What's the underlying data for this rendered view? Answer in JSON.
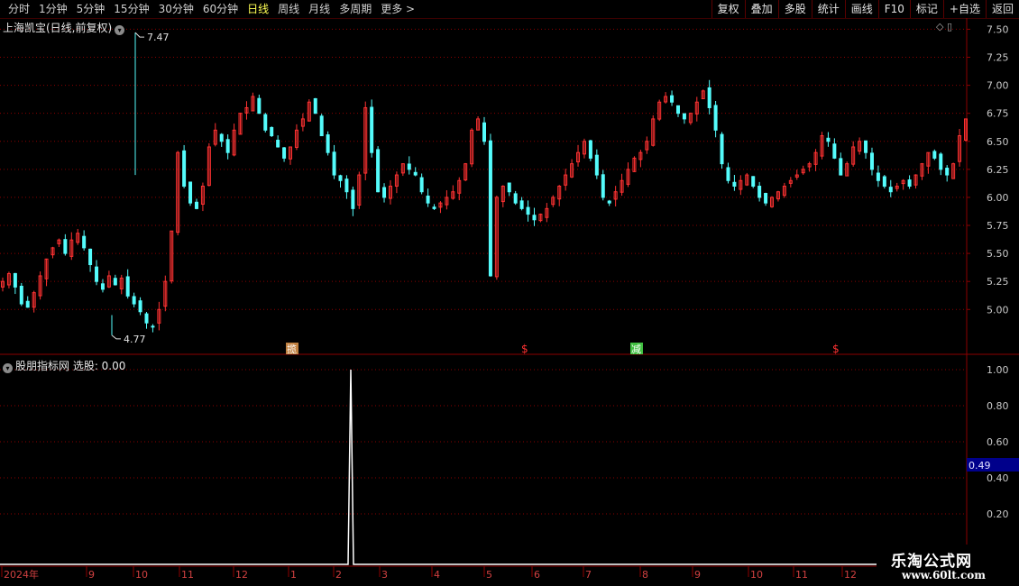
{
  "toolbar": {
    "periods": [
      "分时",
      "1分钟",
      "5分钟",
      "15分钟",
      "30分钟",
      "60分钟",
      "日线",
      "周线",
      "月线",
      "多周期",
      "更多 >"
    ],
    "active_period": "日线",
    "buttons": [
      "复权",
      "叠加",
      "多股",
      "统计",
      "画线",
      "F10",
      "标记",
      "+自选",
      "返回"
    ]
  },
  "stock_title": "上海凯宝(日线,前复权)",
  "indicator_title": "股朋指标网  选股: 0.00",
  "top_icons": "◇ ▯",
  "colors": {
    "up": "#ff3232",
    "down": "#54fcfc",
    "grid": "#8b0000",
    "axis": "#c8c8c8",
    "border": "#8b0000",
    "highlight": "#00008b"
  },
  "watermark": {
    "line1": "乐淘公式网",
    "line2": "www.60lt.com"
  },
  "chart_data": [
    {
      "type": "candlestick",
      "title": "上海凯宝(日线,前复权)",
      "ylim": [
        4.6,
        7.6
      ],
      "yticks": [
        5.0,
        5.25,
        5.5,
        5.75,
        6.0,
        6.25,
        6.5,
        6.75,
        7.0,
        7.25,
        7.5
      ],
      "ytick_labels": [
        "5.00",
        "5.25",
        "5.50",
        "5.75",
        "6.00",
        "6.25",
        "6.50",
        "6.75",
        "7.00",
        "7.25",
        "7.50"
      ],
      "annotations": [
        {
          "label": "7.47",
          "value": 7.47
        },
        {
          "label": "4.77",
          "value": 4.77
        }
      ],
      "markers": [
        {
          "label": "揽",
          "color": "#c08040"
        },
        {
          "label": "$",
          "color": "#ff3232"
        },
        {
          "label": "减",
          "color": "#40c040"
        },
        {
          "label": "$",
          "color": "#ff3232"
        }
      ],
      "close_path": [
        5.25,
        5.32,
        5.2,
        5.05,
        5.02,
        5.15,
        5.3,
        5.45,
        5.55,
        5.62,
        5.5,
        5.62,
        5.68,
        5.55,
        5.4,
        5.25,
        5.18,
        5.3,
        5.22,
        5.28,
        5.12,
        5.05,
        4.98,
        4.88,
        4.85,
        5.0,
        5.25,
        5.7,
        6.4,
        6.1,
        5.95,
        5.9,
        6.1,
        6.45,
        6.6,
        6.5,
        6.4,
        6.6,
        6.75,
        6.8,
        6.9,
        6.75,
        6.6,
        6.55,
        6.45,
        6.35,
        6.45,
        6.6,
        6.7,
        6.85,
        6.75,
        6.55,
        6.4,
        6.2,
        6.15,
        6.05,
        5.9,
        6.2,
        6.8,
        6.4,
        6.05,
        6.0,
        6.1,
        6.2,
        6.3,
        6.25,
        6.2,
        6.05,
        5.95,
        5.9,
        5.95,
        6.0,
        6.05,
        6.15,
        6.3,
        6.6,
        6.7,
        6.5,
        5.3,
        6.0,
        6.1,
        6.05,
        5.95,
        5.9,
        5.85,
        5.8,
        5.85,
        5.9,
        6.0,
        6.1,
        6.2,
        6.3,
        6.4,
        6.5,
        6.35,
        6.2,
        6.0,
        5.95,
        6.05,
        6.15,
        6.25,
        6.35,
        6.4,
        6.5,
        6.7,
        6.85,
        6.9,
        6.85,
        6.75,
        6.7,
        6.75,
        6.85,
        6.95,
        6.8,
        6.6,
        6.3,
        6.15,
        6.1,
        6.15,
        6.2,
        6.1,
        6.0,
        5.95,
        6.0,
        6.05,
        6.1,
        6.15,
        6.2,
        6.25,
        6.3,
        6.4,
        6.55,
        6.5,
        6.35,
        6.2,
        6.3,
        6.45,
        6.5,
        6.4,
        6.25,
        6.15,
        6.1,
        6.05,
        6.1,
        6.15,
        6.1,
        6.2,
        6.3,
        6.4,
        6.35,
        6.25,
        6.2,
        6.3,
        6.55,
        6.7
      ]
    },
    {
      "type": "line",
      "title": "选股",
      "ylim": [
        0.05,
        1.08
      ],
      "yticks": [
        0.2,
        0.4,
        0.6,
        0.8,
        1.0
      ],
      "ytick_labels": [
        "0.20",
        "0.40",
        "0.60",
        "0.80",
        "1.00"
      ],
      "current_value_label": "0.49",
      "series": [
        {
          "signal_value": 1.0,
          "baseline": 0.0
        }
      ]
    }
  ],
  "xaxis": {
    "labels": [
      "2024年",
      "9",
      "10",
      "11",
      "12",
      "1",
      "2",
      "3",
      "4",
      "5",
      "6",
      "7",
      "8",
      "9",
      "10",
      "11",
      "12"
    ]
  }
}
